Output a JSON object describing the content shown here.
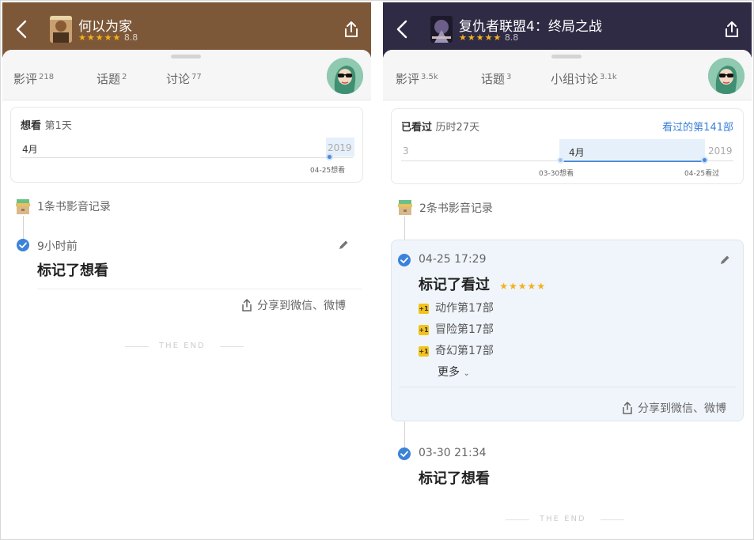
{
  "left": {
    "header": {
      "title": "何以为家",
      "stars": "★★★★★",
      "rating": "8.8"
    },
    "tabs": [
      {
        "label": "影评",
        "count": "218"
      },
      {
        "label": "话题",
        "count": "2"
      },
      {
        "label": "讨论",
        "count": "77"
      }
    ],
    "status_box": {
      "status": "想看",
      "duration": "第1天",
      "month": "4月",
      "year": "2019",
      "marker_date": "04-25想看"
    },
    "record_count": "1条书影音记录",
    "entries": [
      {
        "time": "9小时前",
        "action": "标记了想看"
      }
    ],
    "share": "分享到微信、微博",
    "the_end": "THE END"
  },
  "right": {
    "header": {
      "title": "复仇者联盟4：终局之战",
      "stars": "★★★★★",
      "rating": "8.8"
    },
    "tabs": [
      {
        "label": "影评",
        "count": "3.5k"
      },
      {
        "label": "话题",
        "count": "3"
      },
      {
        "label": "小组讨论",
        "count": "3.1k"
      }
    ],
    "status_box": {
      "status": "已看过",
      "duration": "历时27天",
      "link": "看过的第141部",
      "start_tick": "3",
      "month": "4月",
      "year": "2019",
      "start_date": "03-30想看",
      "end_date": "04-25看过"
    },
    "record_count": "2条书影音记录",
    "entries": [
      {
        "time": "04-25 17:29",
        "action": "标记了看过",
        "stars": "★★★★★",
        "tags": [
          "动作第17部",
          "冒险第17部",
          "奇幻第17部"
        ],
        "badge": "+1",
        "more": "更多"
      },
      {
        "time": "03-30 21:34",
        "action": "标记了想看"
      }
    ],
    "share": "分享到微信、微博",
    "the_end": "THE END"
  },
  "colors": {
    "left_header": "#7d5838",
    "right_header": "#2f2b45",
    "accent_blue": "#3b82d9",
    "star": "#f2b11c"
  }
}
